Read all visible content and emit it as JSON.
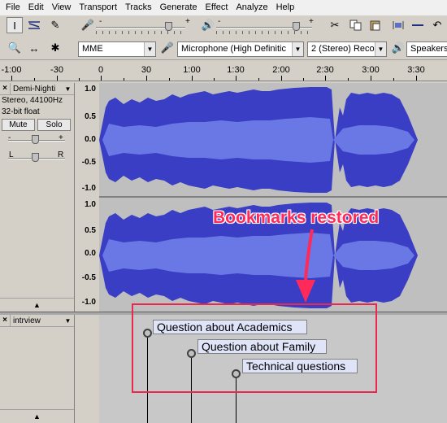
{
  "menu": [
    "File",
    "Edit",
    "View",
    "Transport",
    "Tracks",
    "Generate",
    "Effect",
    "Analyze",
    "Help"
  ],
  "device_toolbar": {
    "host": "MME",
    "recording_device": "Microphone (High Definitic",
    "channels": "2 (Stereo) Recor",
    "playback_device": "Speakers"
  },
  "ruler": {
    "labels": [
      "-1:00",
      "-30",
      "0",
      "30",
      "1:00",
      "1:30",
      "2:00",
      "2:30",
      "3:00",
      "3:30"
    ]
  },
  "audio_track": {
    "name": "Demi-Nighti",
    "rate": "Stereo, 44100Hz",
    "format": "32-bit float",
    "mute_label": "Mute",
    "solo_label": "Solo",
    "gain_minus": "-",
    "gain_plus": "+",
    "pan_left": "L",
    "pan_right": "R",
    "scale_top": [
      "1.0",
      "0.5",
      "0.0",
      "-0.5",
      "-1.0"
    ],
    "scale_bottom": [
      "1.0",
      "0.5",
      "0.0",
      "-0.5",
      "-1.0"
    ]
  },
  "label_track": {
    "name": "intrview",
    "labels": [
      "Question about Academics",
      "Question about Family",
      "Technical questions"
    ]
  },
  "annotation": {
    "text": "Bookmarks restored",
    "color": "#ff2a5a"
  }
}
